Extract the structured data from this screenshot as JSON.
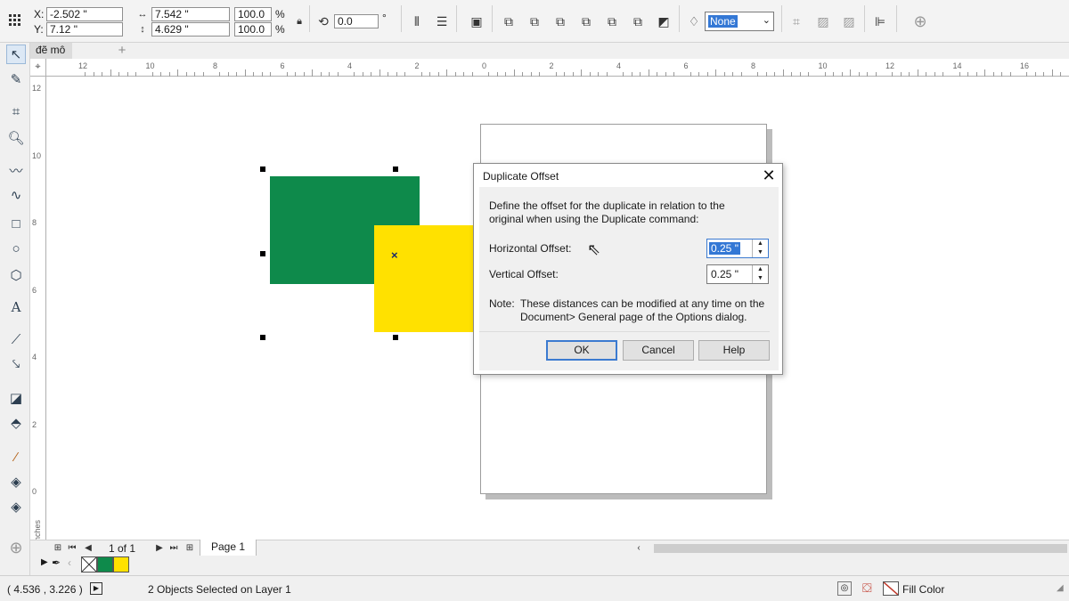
{
  "propbar": {
    "x_label": "X:",
    "x_value": "-2.502 \"",
    "y_label": "Y:",
    "y_value": "7.12 \"",
    "width_value": "7.542 \"",
    "height_value": "4.629 \"",
    "scale_x": "100.0",
    "scale_y": "100.0",
    "percent": "%",
    "rotation_value": "0.0",
    "degree": "°",
    "outline_select": "None"
  },
  "doctabs": {
    "tab_label": "đẽ mô",
    "add": "+"
  },
  "rulers": {
    "h_ticks": [
      "12",
      "10",
      "8",
      "6",
      "4",
      "2",
      "0",
      "2",
      "4",
      "6",
      "8",
      "10",
      "12",
      "14",
      "16"
    ],
    "v_ticks": [
      "12",
      "10",
      "8",
      "6",
      "4",
      "2",
      "0"
    ],
    "unit": "inches"
  },
  "dialog": {
    "title": "Duplicate Offset",
    "close": "✕",
    "description": "Define the offset for the duplicate in relation to the original when using the Duplicate command:",
    "h_label": "Horizontal Offset:",
    "h_value": "0.25 \"",
    "v_label": "Vertical Offset:",
    "v_value": "0.25 \"",
    "note_label": "Note:",
    "note_text": "These distances can be modified at any time on the Document> General page of the Options dialog.",
    "ok": "OK",
    "cancel": "Cancel",
    "help": "Help"
  },
  "pagenav": {
    "page_count": "1 of 1",
    "page_tab": "Page 1"
  },
  "status": {
    "coords": "( 4.536 , 3.226 )",
    "selection": "2 Objects Selected on Layer 1",
    "fill_label": "Fill Color"
  },
  "colors": {
    "green": "#0e8a4b",
    "yellow": "#ffe100",
    "accent": "#3478d5"
  }
}
